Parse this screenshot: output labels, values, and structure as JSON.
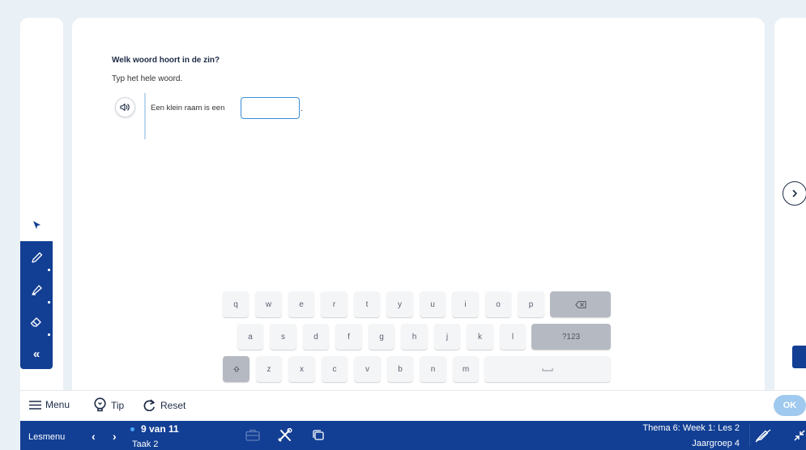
{
  "exercise": {
    "question": "Welk woord hoort in de zin?",
    "instruction": "Typ het hele woord.",
    "sentence_prefix": "Een klein raam is een",
    "answer_value": "",
    "sentence_suffix": "."
  },
  "keyboard": {
    "row1": [
      "q",
      "w",
      "e",
      "r",
      "t",
      "y",
      "u",
      "i",
      "o",
      "p"
    ],
    "row2": [
      "a",
      "s",
      "d",
      "f",
      "g",
      "h",
      "j",
      "k",
      "l"
    ],
    "row3": [
      "z",
      "x",
      "c",
      "v",
      "b",
      "n",
      "m"
    ],
    "numbers_key": "?123",
    "backspace_icon": "backspace-icon",
    "shift_icon": "shift-icon",
    "space_icon": "space-icon"
  },
  "tools": {
    "items": [
      "pointer-icon",
      "pencil-icon",
      "highlighter-icon",
      "eraser-icon"
    ],
    "collapse_label": "«"
  },
  "toolbar": {
    "menu_label": "Menu",
    "tip_label": "Tip",
    "reset_label": "Reset",
    "ok_label": "OK"
  },
  "bottom_bar": {
    "lesmenu_label": "Lesmenu",
    "prev_label": "‹",
    "next_label": "›",
    "progress": "9 van 11",
    "task": "Taak 2",
    "theme": "Thema 6: Week 1: Les 2",
    "year": "Jaargroep 4"
  },
  "colors": {
    "brand": "#123f94",
    "background": "#e9f1f6",
    "input_border": "#3a8fd8",
    "ok_button": "#9fc9ee"
  }
}
